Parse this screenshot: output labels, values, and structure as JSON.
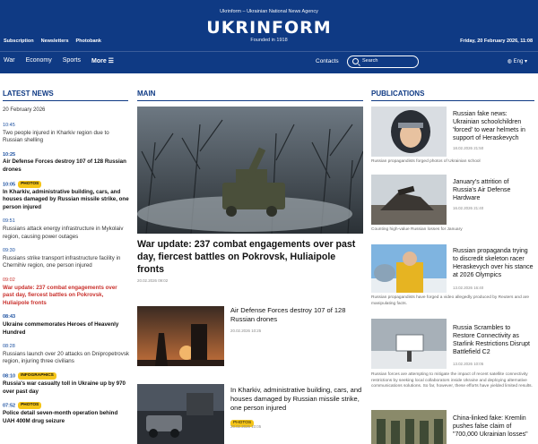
{
  "header": {
    "agency": "Ukrinform – Ukrainian National News Agency",
    "logo": "UKRINFORM",
    "founded": "Founded in 1918",
    "links": [
      "Subscription",
      "Newsletters",
      "Photobank"
    ],
    "date": "Friday, 20 February 2026, 11:08",
    "colors": {
      "primary": "#0f3a84",
      "badge": "#f5c518",
      "alert": "#c9302c"
    }
  },
  "nav": {
    "items": [
      "War",
      "Economy",
      "Sports"
    ],
    "more": "More ☰",
    "contacts": "Contacts",
    "search_placeholder": "Search",
    "lang": "Eng",
    "icons": [
      "search-icon",
      "globe-icon",
      "chevron-down-icon",
      "menu-icon"
    ]
  },
  "latest": {
    "title": "LATEST NEWS",
    "day": "20 February 2026",
    "items": [
      {
        "time": "10:45",
        "text": "Two people injured in Kharkiv region due to Russian shelling"
      },
      {
        "time": "10:25",
        "text": "Air Defense Forces destroy 107 of 128 Russian drones"
      },
      {
        "time": "10:05",
        "badge": "PHOTOS",
        "text": "In Kharkiv, administrative building, cars, and houses damaged by Russian missile strike, one person injured"
      },
      {
        "time": "09:51",
        "text": "Russians attack energy infrastructure in Mykolaiv region, causing power outages"
      },
      {
        "time": "09:30",
        "text": "Russians strike transport infrastructure facility in Chernihiv region, one person injured"
      },
      {
        "time": "09:02",
        "text": "War update: 237 combat engagements over past day, fiercest battles on Pokrovsk, Huliaipole fronts"
      },
      {
        "time": "08:43",
        "text": "Ukraine commemorates Heroes of Heavenly Hundred"
      },
      {
        "time": "08:28",
        "text": "Russians launch over 20 attacks on Dnipropetrovsk region, injuring three civilians"
      },
      {
        "time": "08:10",
        "badge": "INFOGRAPHICS",
        "text": "Russia's war casualty toll in Ukraine up by 970 over past day"
      },
      {
        "time": "07:52",
        "badge": "PHOTOS",
        "text": "Police detail seven-month operation behind UAH 400M drug seizure"
      }
    ]
  },
  "main": {
    "title": "MAIN",
    "hero": {
      "title": "War update: 237 combat engagements over past day, fiercest battles on Pokrovsk, Huliaipole fronts",
      "date": "20.02.2026 09:02"
    },
    "items": [
      {
        "title": "Air Defense Forces destroy 107 of 128 Russian drones",
        "date": "20.02.2026 10:25"
      },
      {
        "title": "In Kharkiv, administrative building, cars, and houses damaged by Russian missile strike, one person injured",
        "date": "20.02.2026 10:05",
        "badge": "PHOTOS"
      }
    ]
  },
  "publications": {
    "title": "PUBLICATIONS",
    "items": [
      {
        "title": "Russian fake news: Ukrainian schoolchildren 'forced' to wear helmets in support of Heraskevych",
        "date": "18.02.2026 21:50",
        "caption": "Russian propagandists forged photos of Ukrainian school"
      },
      {
        "title": "January's attrition of Russia's Air Defense Hardware",
        "date": "16.02.2026 21:40",
        "caption": "Counting high-value Russian losses for January"
      },
      {
        "title": "Russian propaganda trying to discredit skeleton racer Heraskevych over his stance at 2026 Olympics",
        "date": "13.02.2026 16:40",
        "caption": "Russian propagandists have forged a video allegedly produced by Reuters and are manipulating facts."
      },
      {
        "title": "Russia Scrambles to Restore Connectivity as Starlink Restrictions Disrupt Battlefield C2",
        "date": "13.02.2026 10:05",
        "caption": "Russian forces are attempting to mitigate the impact of recent satellite connectivity restrictions by seeking local collaborators inside Ukraine and deploying alternative communications solutions. So far, however, these efforts have yielded limited results."
      },
      {
        "title": "China-linked fake: Kremlin pushes false claim of \"700,000 Ukrainian losses\"",
        "date": "",
        "caption": ""
      }
    ]
  }
}
